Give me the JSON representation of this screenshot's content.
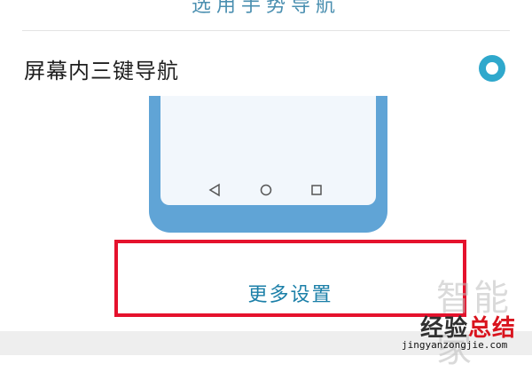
{
  "top_partial_text": "选用手势导航",
  "option": {
    "label": "屏幕内三键导航",
    "selected": true
  },
  "phone_preview": {
    "nav_icons": [
      "back-triangle-icon",
      "home-circle-icon",
      "recent-square-icon"
    ]
  },
  "more_settings": {
    "label": "更多设置"
  },
  "watermark": {
    "top": "智能家",
    "main_a": "经验",
    "main_b": "总结",
    "url": "jingyanzongjie.com"
  },
  "colors": {
    "accent": "#2fa8cc",
    "link_text": "#1b7fa8",
    "highlight_box": "#e5122d",
    "phone_body": "#60a4d6"
  }
}
